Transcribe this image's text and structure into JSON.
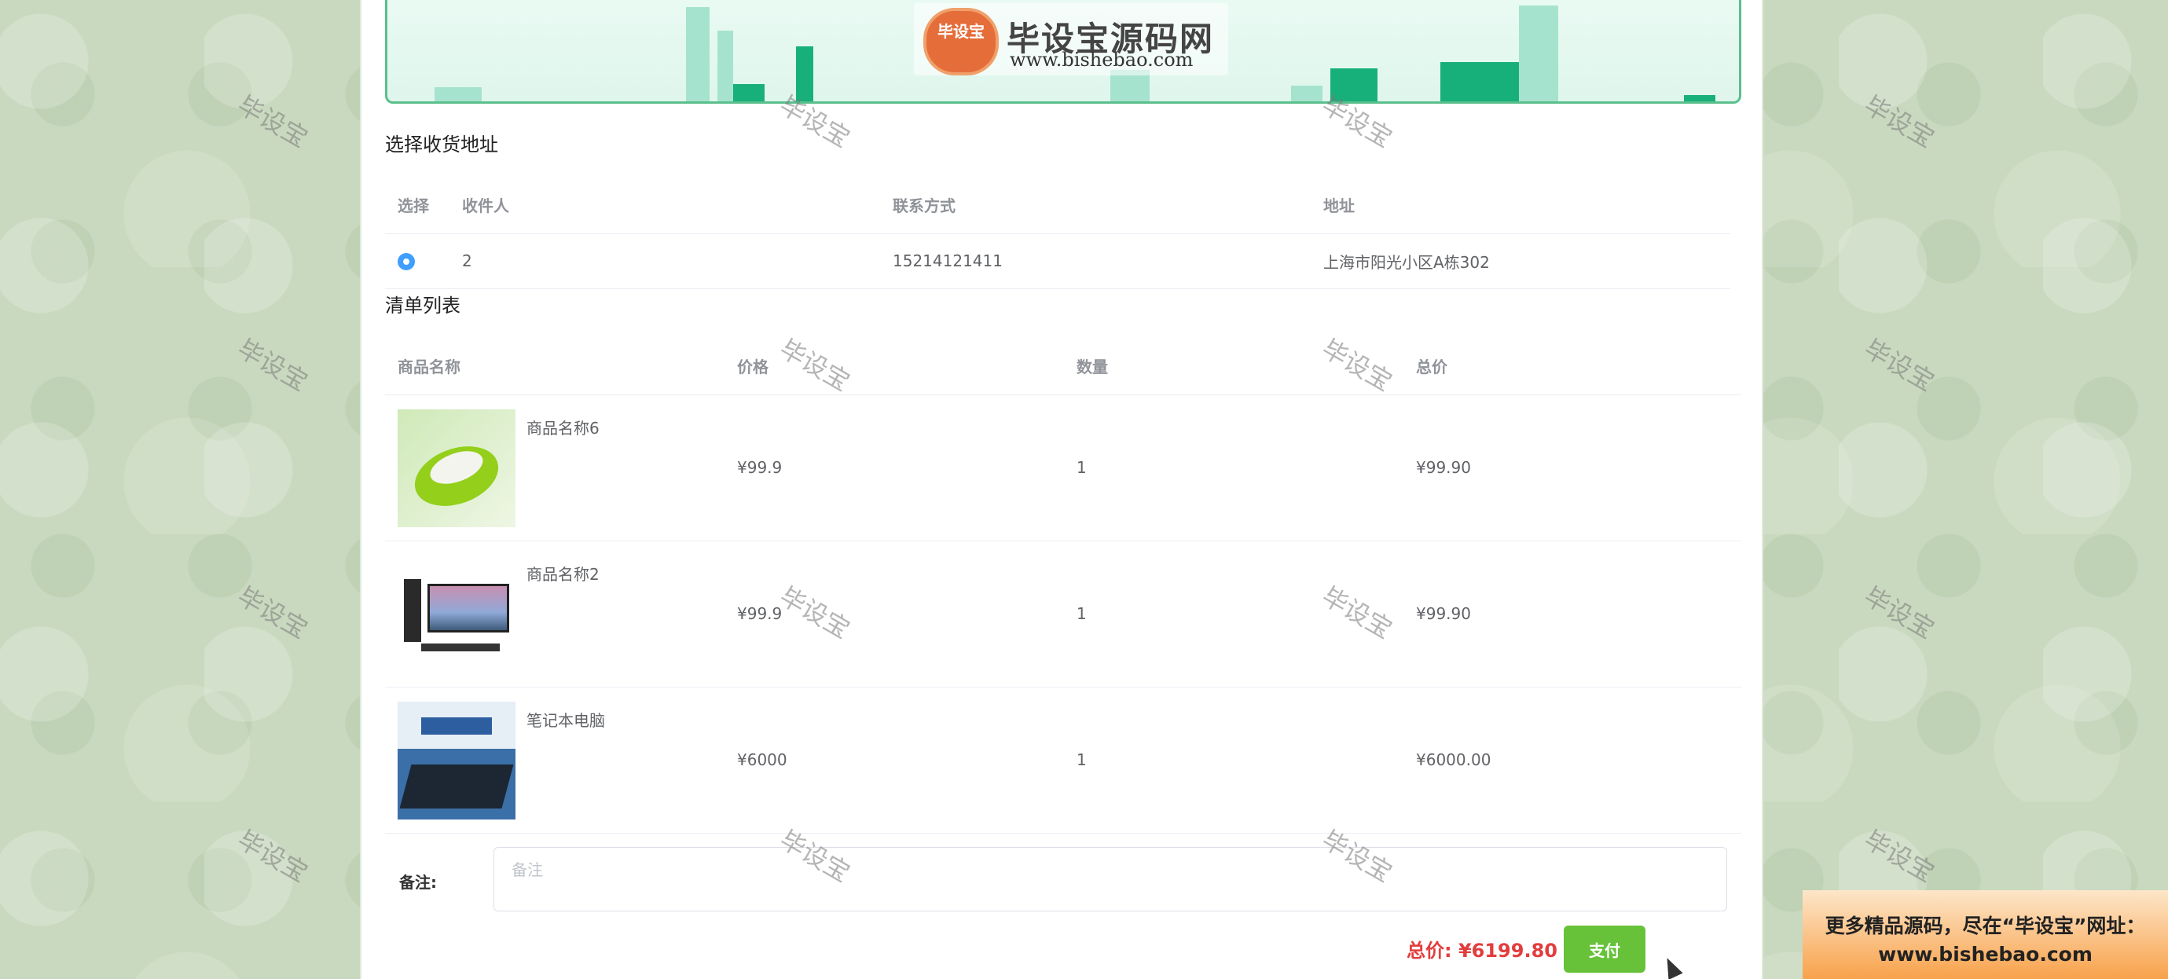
{
  "brand": {
    "badge": "毕设宝",
    "title": "毕设宝源码网",
    "url": "www.bishebao.com"
  },
  "address_section": {
    "title": "选择收货地址",
    "columns": [
      "选择",
      "收件人",
      "联系方式",
      "地址"
    ],
    "rows": [
      {
        "selected": true,
        "recipient": "2",
        "phone": "15214121411",
        "address": "上海市阳光小区A栋302"
      }
    ]
  },
  "cart_section": {
    "title": "清单列表",
    "columns": [
      "商品名称",
      "价格",
      "数量",
      "总价"
    ],
    "items": [
      {
        "name": "商品名称6",
        "price": "¥99.9",
        "qty": "1",
        "subtotal": "¥99.90",
        "image": "bowl-image"
      },
      {
        "name": "商品名称2",
        "price": "¥99.9",
        "qty": "1",
        "subtotal": "¥99.90",
        "image": "desktop-computer-image"
      },
      {
        "name": "笔记本电脑",
        "price": "¥6000",
        "qty": "1",
        "subtotal": "¥6000.00",
        "image": "laptop-image"
      }
    ]
  },
  "remark": {
    "label": "备注:",
    "placeholder": "备注",
    "value": ""
  },
  "summary": {
    "total_label": "总价: ¥6199.80",
    "pay_button": "支付"
  },
  "watermark": "毕设宝",
  "promo": {
    "line1": "更多精品源码，尽在“毕设宝”网址：",
    "line2": "www.bishebao.com"
  },
  "colors": {
    "accent_green": "#67c23a",
    "radio_blue": "#409eff",
    "total_red": "#e23d3d",
    "banner_border": "#5bbf8c"
  }
}
